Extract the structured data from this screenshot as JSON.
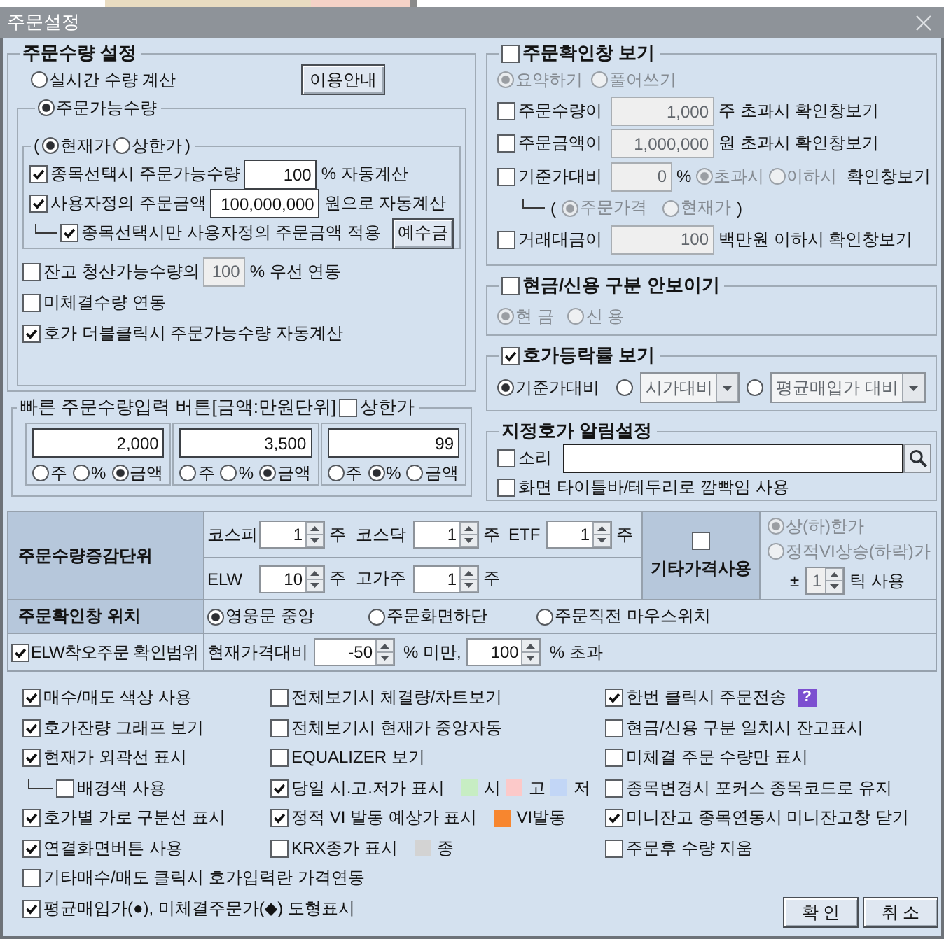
{
  "window": {
    "title": "주문설정"
  },
  "order_quantity": {
    "title": "주문수량 설정",
    "realtime": {
      "label": "실시간 수량 계산",
      "selected": false
    },
    "guide_button": "이용안내",
    "available": {
      "label": "주문가능수량",
      "selected": true
    },
    "price_basis": {
      "open": "(",
      "close": ")",
      "options": [
        {
          "label": "현재가",
          "selected": true
        },
        {
          "label": "상한가",
          "selected": false
        }
      ]
    },
    "auto_rows": [
      {
        "checked": true,
        "label": "종목선택시 주문가능수량",
        "field": {
          "value": "100",
          "disabled": false
        },
        "unit": "% 자동계산"
      },
      {
        "checked": true,
        "label": "사용자정의 주문금액",
        "field": {
          "value": "100,000,000",
          "disabled": false
        },
        "unit": "원으로 자동계산"
      }
    ],
    "selected_only": {
      "checked": true,
      "label": "종목선택시만 사용자정의 주문금액 적용",
      "button": "예수금"
    },
    "liquidation": {
      "checked": false,
      "label": "잔고 청산가능수량의",
      "field": {
        "value": "100",
        "disabled": true
      },
      "unit": "% 우선 연동"
    },
    "options": [
      {
        "checked": false,
        "label": "미체결수량 연동"
      },
      {
        "checked": true,
        "label": "호가 더블클릭시 주문가능수량 자동계산"
      }
    ]
  },
  "quick_buttons": {
    "title": "빠른 주문수량입력 버튼[금액:만원단위]",
    "upper_limit": {
      "checked": false,
      "label": "상한가"
    },
    "slots": [
      {
        "value": "2,000",
        "units": [
          {
            "label": "주",
            "selected": false
          },
          {
            "label": "%",
            "selected": false
          },
          {
            "label": "금액",
            "selected": true
          }
        ]
      },
      {
        "value": "3,500",
        "units": [
          {
            "label": "주",
            "selected": false
          },
          {
            "label": "%",
            "selected": false
          },
          {
            "label": "금액",
            "selected": true
          }
        ]
      },
      {
        "value": "99",
        "units": [
          {
            "label": "주",
            "selected": false
          },
          {
            "label": "%",
            "selected": true
          },
          {
            "label": "금액",
            "selected": false
          }
        ]
      }
    ]
  },
  "confirm_window": {
    "title": {
      "checked": false,
      "label": "주문확인창 보기"
    },
    "style": {
      "disabled": true,
      "options": [
        {
          "label": "요약하기",
          "selected": true
        },
        {
          "label": "풀어쓰기",
          "selected": false
        }
      ]
    },
    "rows": [
      {
        "checked": false,
        "label": "주문수량이",
        "field": {
          "value": "1,000",
          "disabled": true
        },
        "unit": "주 초과시 확인창보기"
      },
      {
        "checked": false,
        "label": "주문금액이",
        "field": {
          "value": "1,000,000",
          "disabled": true
        },
        "unit": "원 초과시 확인창보기"
      }
    ],
    "base_price": {
      "checked": false,
      "label": "기준가대비",
      "field": {
        "value": "0",
        "disabled": true
      },
      "unit": "%",
      "compare": {
        "disabled": true,
        "options": [
          {
            "label": "초과시",
            "selected": true
          },
          {
            "label": "이하시",
            "selected": false
          }
        ]
      },
      "suffix": "확인창보기"
    },
    "base_price_ref": {
      "open": "(",
      "close": ")",
      "disabled": true,
      "options": [
        {
          "label": "주문가격",
          "selected": true
        },
        {
          "label": "현재가",
          "selected": false
        }
      ]
    },
    "trade_amount": {
      "checked": false,
      "label": "거래대금이",
      "field": {
        "value": "100",
        "disabled": true
      },
      "unit": "백만원 이하시 확인창보기"
    }
  },
  "cash_credit": {
    "title": {
      "checked": false,
      "label": "현금/신용 구분 안보이기"
    },
    "disabled": true,
    "options": [
      {
        "label": "현 금",
        "selected": true
      },
      {
        "label": "신 용",
        "selected": false
      }
    ]
  },
  "quote_rate": {
    "title": {
      "checked": true,
      "label": "호가등락률 보기"
    },
    "options": [
      {
        "kind": "label",
        "label": "기준가대비",
        "selected": true
      },
      {
        "kind": "dropdown",
        "value": "시가대비",
        "selected": false,
        "disabled": true
      },
      {
        "kind": "dropdown",
        "value": "평균매입가 대비",
        "selected": false,
        "disabled": true
      }
    ]
  },
  "price_alert": {
    "title": "지정호가 알림설정",
    "sound": {
      "checked": false,
      "label": "소리"
    },
    "flash": {
      "checked": false,
      "label": "화면 타이틀바/테두리로 깜빡임 사용"
    }
  },
  "qty_step": {
    "header": "주문수량증감단위",
    "lines": [
      {
        "fields": [
          {
            "label": "코스피",
            "value": "1",
            "unit": "주"
          },
          {
            "label": "코스닥",
            "value": "1",
            "unit": "주"
          },
          {
            "label": "ETF",
            "value": "1",
            "unit": "주"
          }
        ]
      },
      {
        "fields": [
          {
            "label": "ELW",
            "value": "10",
            "unit": "주"
          },
          {
            "label": "고가주",
            "value": "1",
            "unit": "주"
          }
        ]
      }
    ]
  },
  "other_price": {
    "checked": false,
    "label": "기타가격사용",
    "disabled": true,
    "options": [
      {
        "label": "상(하)한가",
        "selected": true
      },
      {
        "label": "정적VI상승(하락)가",
        "selected": false
      }
    ],
    "tick": {
      "prefix": "±",
      "value": "1",
      "unit": "틱 사용"
    }
  },
  "confirm_position": {
    "header": "주문확인창 위치",
    "options": [
      {
        "label": "영웅문 중앙",
        "selected": true
      },
      {
        "label": "주문화면하단",
        "selected": false
      },
      {
        "label": "주문직전 마우스위치",
        "selected": false
      }
    ]
  },
  "elw_range": {
    "checked": true,
    "label": "ELW착오주문 확인범위",
    "prefix": "현재가격대비",
    "low": {
      "value": "-50",
      "unit": "% 미만,"
    },
    "high": {
      "value": "100",
      "unit": "% 초과"
    }
  },
  "display_options": {
    "columns": [
      {
        "items": [
          {
            "checked": true,
            "label": "매수/매도 색상 사용"
          },
          {
            "checked": true,
            "label": "호가잔량 그래프 보기"
          },
          {
            "checked": true,
            "label": "현재가 외곽선 표시",
            "children": [
              {
                "checked": false,
                "label": "배경색 사용"
              }
            ]
          },
          {
            "checked": true,
            "label": "호가별 가로 구분선 표시"
          },
          {
            "checked": true,
            "label": "연결화면버튼 사용"
          }
        ]
      },
      {
        "items": [
          {
            "checked": false,
            "label": "전체보기시 체결량/차트보기"
          },
          {
            "checked": false,
            "label": "전체보기시 현재가 중앙자동"
          },
          {
            "checked": false,
            "label": "EQUALIZER 보기"
          },
          {
            "checked": true,
            "label": "당일 시.고.저가 표시",
            "legend": [
              {
                "label": "시",
                "color": "#c7edc3"
              },
              {
                "label": "고",
                "color": "#fcc9c9"
              },
              {
                "label": "저",
                "color": "#c2d6f6"
              }
            ]
          },
          {
            "checked": true,
            "label": "정적 VI 발동 예상가 표시",
            "legend": [
              {
                "label": "VI발동",
                "color": "#f7862f"
              }
            ]
          },
          {
            "checked": false,
            "label": "KRX종가 표시",
            "legend": [
              {
                "label": "종",
                "color": "#d3d3d3"
              }
            ]
          }
        ]
      },
      {
        "items": [
          {
            "checked": true,
            "label": "한번 클릭시 주문전송",
            "help": "?"
          },
          {
            "checked": false,
            "label": "현금/신용 구분 일치시 잔고표시"
          },
          {
            "checked": false,
            "label": "미체결 주문 수량만 표시"
          },
          {
            "checked": false,
            "label": "종목변경시 포커스 종목코드로 유지"
          },
          {
            "checked": true,
            "label": "미니잔고 종목연동시 미니잔고창 닫기"
          },
          {
            "checked": false,
            "label": "주문후 수량 지움"
          }
        ]
      }
    ],
    "wide_items": [
      {
        "checked": false,
        "label": "기타매수/매도 클릭시 호가입력란 가격연동"
      },
      {
        "checked": true,
        "label": "평균매입가(●), 미체결주문가(◆) 도형표시"
      }
    ]
  },
  "buttons": [
    "확 인",
    "취 소"
  ]
}
